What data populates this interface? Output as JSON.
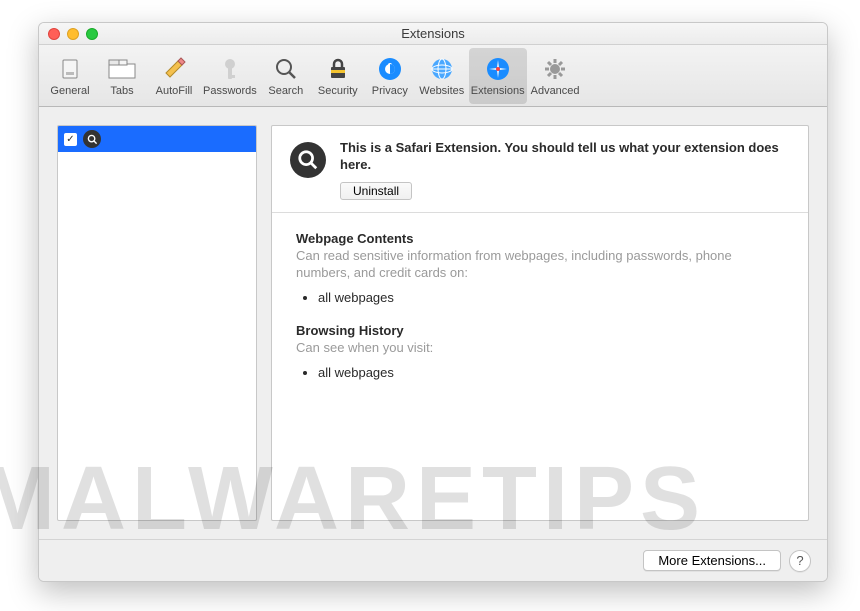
{
  "window": {
    "title": "Extensions"
  },
  "toolbar": {
    "items": [
      {
        "label": "General"
      },
      {
        "label": "Tabs"
      },
      {
        "label": "AutoFill"
      },
      {
        "label": "Passwords"
      },
      {
        "label": "Search"
      },
      {
        "label": "Security"
      },
      {
        "label": "Privacy"
      },
      {
        "label": "Websites"
      },
      {
        "label": "Extensions"
      },
      {
        "label": "Advanced"
      }
    ]
  },
  "detail": {
    "description": "This is a Safari Extension. You should tell us what your extension does here.",
    "uninstall_label": "Uninstall",
    "perm1_heading": "Webpage Contents",
    "perm1_desc": "Can read sensitive information from webpages, including passwords, phone numbers, and credit cards on:",
    "perm1_item": "all webpages",
    "perm2_heading": "Browsing History",
    "perm2_desc": "Can see when you visit:",
    "perm2_item": "all webpages"
  },
  "footer": {
    "more_label": "More Extensions...",
    "help_label": "?"
  },
  "watermark": "MALWARETIPS"
}
